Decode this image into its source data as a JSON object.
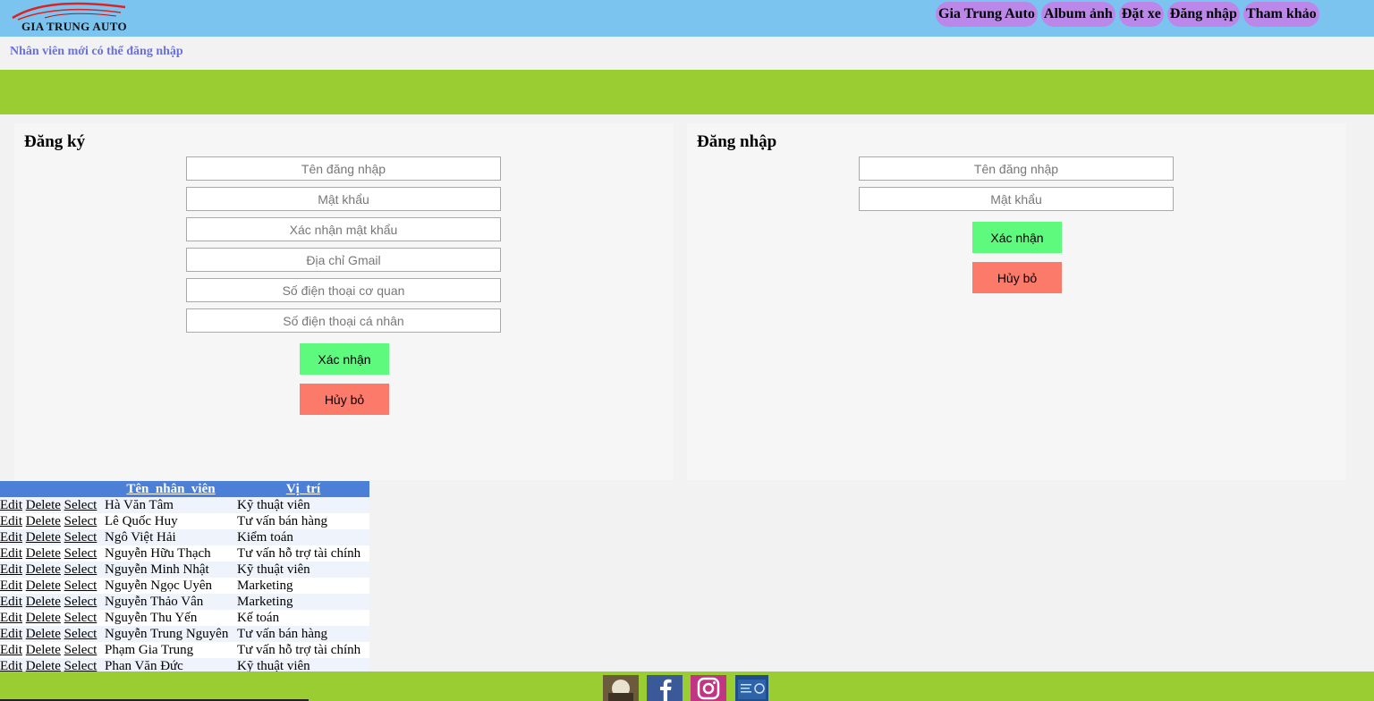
{
  "header": {
    "logo_text": "GIA TRUNG AUTO",
    "nav": [
      "Gia Trung Auto",
      "Album ảnh",
      "Đặt xe",
      "Đăng nhập",
      "Tham khảo"
    ]
  },
  "notice": "Nhân viên mới có thể đăng nhập",
  "register": {
    "title": "Đăng ký",
    "fields": [
      "Tên đăng nhập",
      "Mật khẩu",
      "Xác nhận mật khẩu",
      "Địa chỉ Gmail",
      "Số điện thoại cơ quan",
      "Số điện thoại cá nhân"
    ],
    "confirm_label": "Xác nhận",
    "cancel_label": "Hủy bỏ"
  },
  "login": {
    "title": "Đăng nhập",
    "fields": [
      "Tên đăng nhập",
      "Mật khẩu"
    ],
    "confirm_label": "Xác nhận",
    "cancel_label": "Hủy bỏ"
  },
  "table": {
    "headers": [
      "Tên_nhân_viên",
      "Vị_trí"
    ],
    "commands": [
      "Edit",
      "Delete",
      "Select"
    ],
    "rows": [
      [
        "Hà Văn Tâm",
        "Kỹ thuật viên"
      ],
      [
        "Lê Quốc Huy",
        "Tư vấn bán hàng"
      ],
      [
        "Ngô Việt Hải",
        "Kiểm toán"
      ],
      [
        "Nguyễn Hữu Thạch",
        "Tư vấn hỗ trợ tài chính"
      ],
      [
        "Nguyễn Minh Nhật",
        "Kỹ thuật viên"
      ],
      [
        "Nguyễn Ngọc Uyên",
        "Marketing"
      ],
      [
        "Nguyễn Thảo Vân",
        "Marketing"
      ],
      [
        "Nguyễn Thu Yến",
        "Kế toán"
      ],
      [
        "Nguyễn Trung Nguyên",
        "Tư vấn bán hàng"
      ],
      [
        "Phạm Gia Trung",
        "Tư vấn hỗ trợ tài chính"
      ],
      [
        "Phan Văn Đức",
        "Kỹ thuật viên"
      ]
    ]
  },
  "footer": {
    "icons": [
      "photo-icon",
      "facebook-icon",
      "instagram-icon",
      "certificate-icon"
    ]
  },
  "colors": {
    "header_bg": "#7bc4f0",
    "nav_bg": "#bb88ea",
    "band_green": "#9acd32",
    "confirm_green": "#5dfa7e",
    "cancel_red": "#fb7a6a",
    "table_header": "#4c7fd6"
  }
}
